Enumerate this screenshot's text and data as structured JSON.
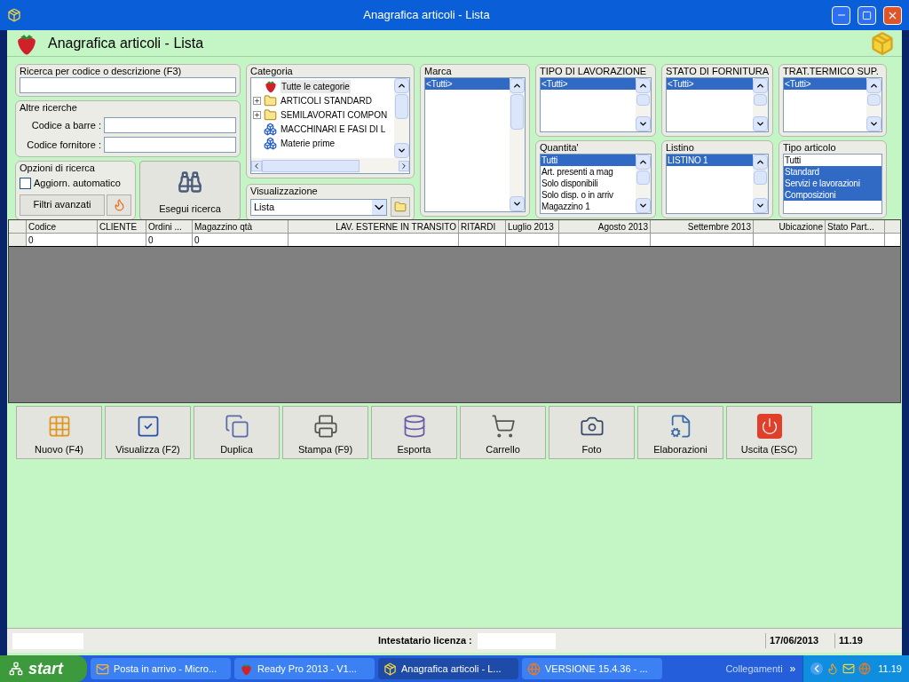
{
  "window": {
    "title": "Anagrafica articoli  - Lista"
  },
  "header": {
    "title": "Anagrafica articoli  - Lista"
  },
  "search": {
    "label": "Ricerca per codice o descrizione (F3)"
  },
  "other_searches": {
    "label": "Altre ricerche",
    "fields": [
      {
        "label": "Codice a barre :"
      },
      {
        "label": "Codice fornitore :"
      }
    ]
  },
  "options": {
    "label": "Opzioni di ricerca",
    "auto_update": {
      "label": "Aggiorn. automatico",
      "checked": false
    },
    "advanced_button": "Filtri avanzati",
    "run_button": "Esegui ricerca"
  },
  "category": {
    "label": "Categoria",
    "tree": [
      {
        "kind": "root",
        "label": "Tutte le categorie",
        "selected": true,
        "expandable": false
      },
      {
        "kind": "folder",
        "label": "ARTICOLI STANDARD",
        "selected": false,
        "expandable": true
      },
      {
        "kind": "folder",
        "label": "SEMILAVORATI COMPON",
        "selected": false,
        "expandable": true
      },
      {
        "kind": "group",
        "label": "MACCHINARI E FASI DI L",
        "selected": false,
        "expandable": false
      },
      {
        "kind": "group",
        "label": "Materie prime",
        "selected": false,
        "expandable": false
      }
    ]
  },
  "view": {
    "label": "Visualizzazione",
    "value": "Lista"
  },
  "lists": [
    {
      "label": "Marca",
      "scrollable": true,
      "items": [
        {
          "label": "<Tutti>",
          "selected": true
        }
      ]
    },
    {
      "label": "TIPO DI LAVORAZIONE",
      "scrollable": true,
      "items": [
        {
          "label": "<Tutti>",
          "selected": true
        }
      ]
    },
    {
      "label": "Quantita'",
      "scrollable": true,
      "items": [
        {
          "label": "Tutti",
          "selected": true
        },
        {
          "label": "Art. presenti a mag",
          "selected": false
        },
        {
          "label": "Solo disponibili",
          "selected": false
        },
        {
          "label": "Solo disp. o in arriv",
          "selected": false
        },
        {
          "label": "Magazzino 1",
          "selected": false
        }
      ]
    },
    {
      "label": "STATO DI FORNITURA",
      "scrollable": true,
      "items": [
        {
          "label": "<Tutti>",
          "selected": true
        }
      ]
    },
    {
      "label": "Listino",
      "scrollable": true,
      "items": [
        {
          "label": "LISTINO 1",
          "selected": true
        }
      ]
    },
    {
      "label": "TRAT.TERMICO SUP.",
      "scrollable": true,
      "items": [
        {
          "label": "<Tutti>",
          "selected": true
        }
      ]
    },
    {
      "label": "Tipo articolo",
      "scrollable": false,
      "items": [
        {
          "label": "Tutti",
          "selected": false
        },
        {
          "label": "Standard",
          "selected": true
        },
        {
          "label": "Servizi e lavorazioni",
          "selected": true
        },
        {
          "label": "Composizioni",
          "selected": true
        }
      ]
    }
  ],
  "table": {
    "columns": [
      {
        "label": "Codice"
      },
      {
        "label": "CLIENTE"
      },
      {
        "label": "Ordini ..."
      },
      {
        "label": "Magazzino qtà"
      },
      {
        "label": "LAV. ESTERNE IN TRANSITO"
      },
      {
        "label": "RITARDI"
      },
      {
        "label": "Luglio 2013"
      },
      {
        "label": "Agosto  2013"
      },
      {
        "label": "Settembre 2013"
      },
      {
        "label": "Ubicazione"
      },
      {
        "label": "Stato Part..."
      }
    ],
    "rows": [
      {
        "cells": [
          "0",
          null,
          "0",
          "0",
          null,
          null,
          null,
          null,
          null,
          null,
          null
        ]
      }
    ]
  },
  "toolbar": [
    {
      "kind": "new",
      "label": "Nuovo (F4)"
    },
    {
      "kind": "view",
      "label": "Visualizza (F2)"
    },
    {
      "kind": "duplicate",
      "label": "Duplica"
    },
    {
      "kind": "print",
      "label": "Stampa (F9)"
    },
    {
      "kind": "export",
      "label": "Esporta"
    },
    {
      "kind": "cart",
      "label": "Carrello"
    },
    {
      "kind": "photo",
      "label": "Foto"
    },
    {
      "kind": "process",
      "label": "Elaborazioni"
    },
    {
      "kind": "exit",
      "label": "Uscita (ESC)"
    }
  ],
  "status_bar": {
    "license_label": "Intestatario licenza :",
    "date": "17/06/2013",
    "time": "11.19"
  },
  "taskbar": {
    "start": "start",
    "tasks": [
      {
        "kind": "mail",
        "label": "Posta in arrivo - Micro...",
        "selected": false
      },
      {
        "kind": "app",
        "label": "Ready Pro 2013 - V1...",
        "selected": false
      },
      {
        "kind": "box",
        "label": "Anagrafica articoli  - L...",
        "selected": true
      },
      {
        "kind": "browser",
        "label": "VERSIONE 15.4.36 - ...",
        "selected": false
      }
    ],
    "links": "Collegamenti",
    "more": "»",
    "clock": "11.19"
  }
}
